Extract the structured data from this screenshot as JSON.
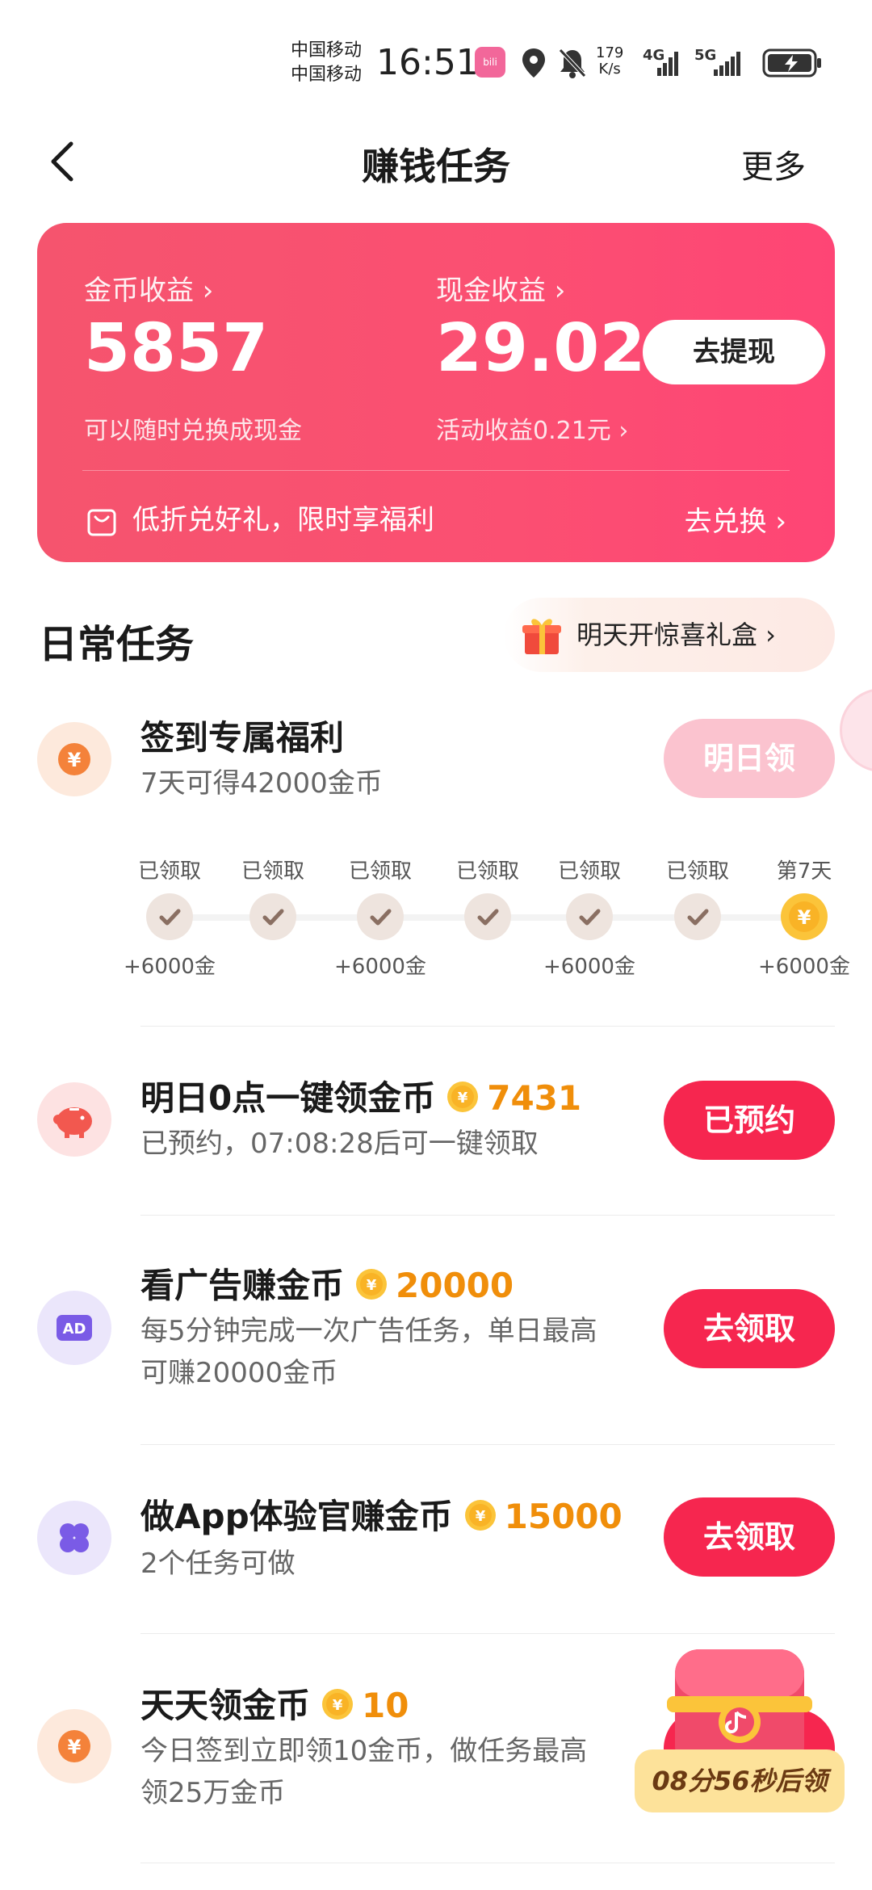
{
  "status_bar": {
    "carrier_1": "中国移动",
    "carrier_2": "中国移动",
    "time": "16:51",
    "net_speed_value": "179",
    "net_speed_unit": "K/s",
    "signal_1": "4G",
    "signal_2": "5G"
  },
  "nav": {
    "title": "赚钱任务",
    "more": "更多"
  },
  "earnings": {
    "coin_label": "金币收益 ›",
    "coin_value": "5857",
    "coin_sub": "可以随时兑换成现金",
    "cash_label": "现金收益 ›",
    "cash_value": "29.02",
    "cash_sub": "活动收益0.21元 ›",
    "withdraw_label": "去提现",
    "promo_text": "低折兑好礼，限时享福利",
    "promo_link": "去兑换 ›"
  },
  "daily": {
    "title": "日常任务",
    "gift_pill": "明天开惊喜礼盒 ›"
  },
  "checkin": {
    "title": "签到专属福利",
    "desc": "7天可得42000金币",
    "button": "明日领",
    "days": [
      {
        "label": "已领取",
        "bonus": "+6000金"
      },
      {
        "label": "已领取",
        "bonus": ""
      },
      {
        "label": "已领取",
        "bonus": "+6000金"
      },
      {
        "label": "已领取",
        "bonus": ""
      },
      {
        "label": "已领取",
        "bonus": "+6000金"
      },
      {
        "label": "已领取",
        "bonus": ""
      },
      {
        "label": "第7天",
        "bonus": "+6000金"
      }
    ]
  },
  "tasks": [
    {
      "title": "明日0点一键领金币",
      "coins": "7431",
      "desc": "已预约，07:08:28后可一键领取",
      "button": "已预约",
      "icon": "piggy-bank-icon"
    },
    {
      "title": "看广告赚金币",
      "coins": "20000",
      "desc_1": "每5分钟完成一次广告任务，单日最高",
      "desc_2": "可赚20000金币",
      "button": "去领取",
      "icon": "ad-icon",
      "icon_text": "AD"
    },
    {
      "title": "做App体验官赚金币",
      "coins": "15000",
      "desc": "2个任务可做",
      "button": "去领取",
      "icon": "clover-icon"
    },
    {
      "title": "天天领金币",
      "coins": "10",
      "desc_1": "今日签到立即领10金币，做任务最高",
      "desc_2": "领25万金币",
      "icon": "yuan-coin-icon"
    }
  ],
  "float_chest": {
    "label": "08分56秒后领"
  },
  "colors": {
    "accent": "#f6264f",
    "card_gradient_start": "#f5546e",
    "card_gradient_end": "#fe4575",
    "coin_orange": "#f08e0a"
  }
}
